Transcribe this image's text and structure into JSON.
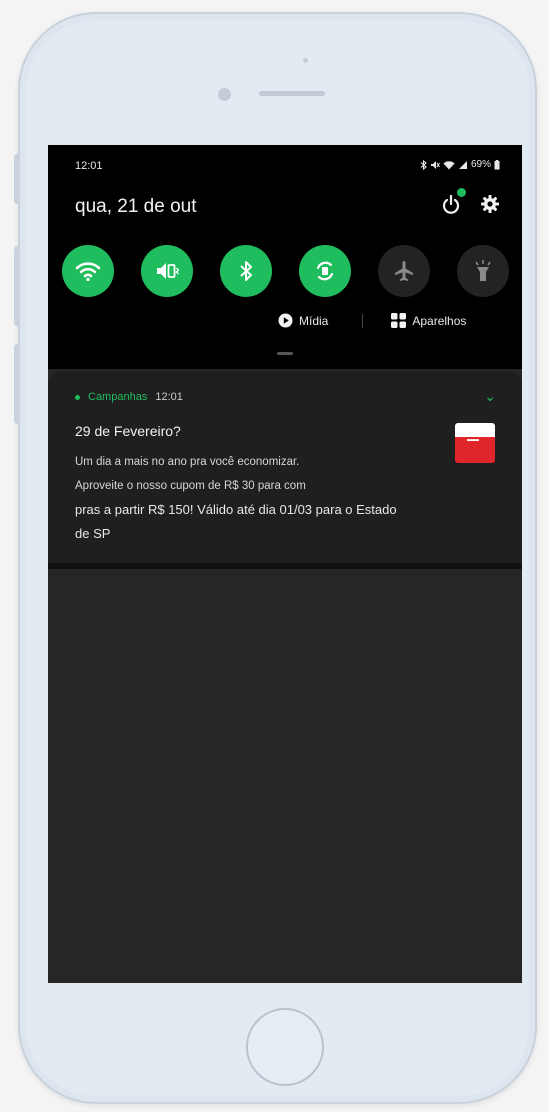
{
  "status_bar": {
    "time": "12:01",
    "battery": "69%"
  },
  "header": {
    "date": "qua, 21 de out"
  },
  "quick_tiles": [
    {
      "name": "wifi",
      "icon": "wifi-icon",
      "active": true
    },
    {
      "name": "sound",
      "icon": "vibrate-icon",
      "active": true
    },
    {
      "name": "bluetooth",
      "icon": "bluetooth-icon",
      "active": true
    },
    {
      "name": "auto-rotate",
      "icon": "rotate-icon",
      "active": true
    },
    {
      "name": "airplane",
      "icon": "airplane-icon",
      "active": false
    },
    {
      "name": "flashlight",
      "icon": "flashlight-icon",
      "active": false
    }
  ],
  "media": {
    "media_label": "Mídia",
    "devices_label": "Aparelhos"
  },
  "notification": {
    "app_name": "Campanhas",
    "time": "12:01",
    "title": "29 de Fevereiro?",
    "body_lines": [
      "Um dia a mais no ano pra você economizar.",
      "Aproveite o nosso cupom de R$ 30 para com",
      "pras a partir R$ 150! Válido até dia 01/03 para o Estado",
      "de SP"
    ]
  },
  "colors": {
    "accent": "#1fbd5e",
    "shade": "#000000",
    "panel": "#262626",
    "frame": "#e2eaf2"
  }
}
